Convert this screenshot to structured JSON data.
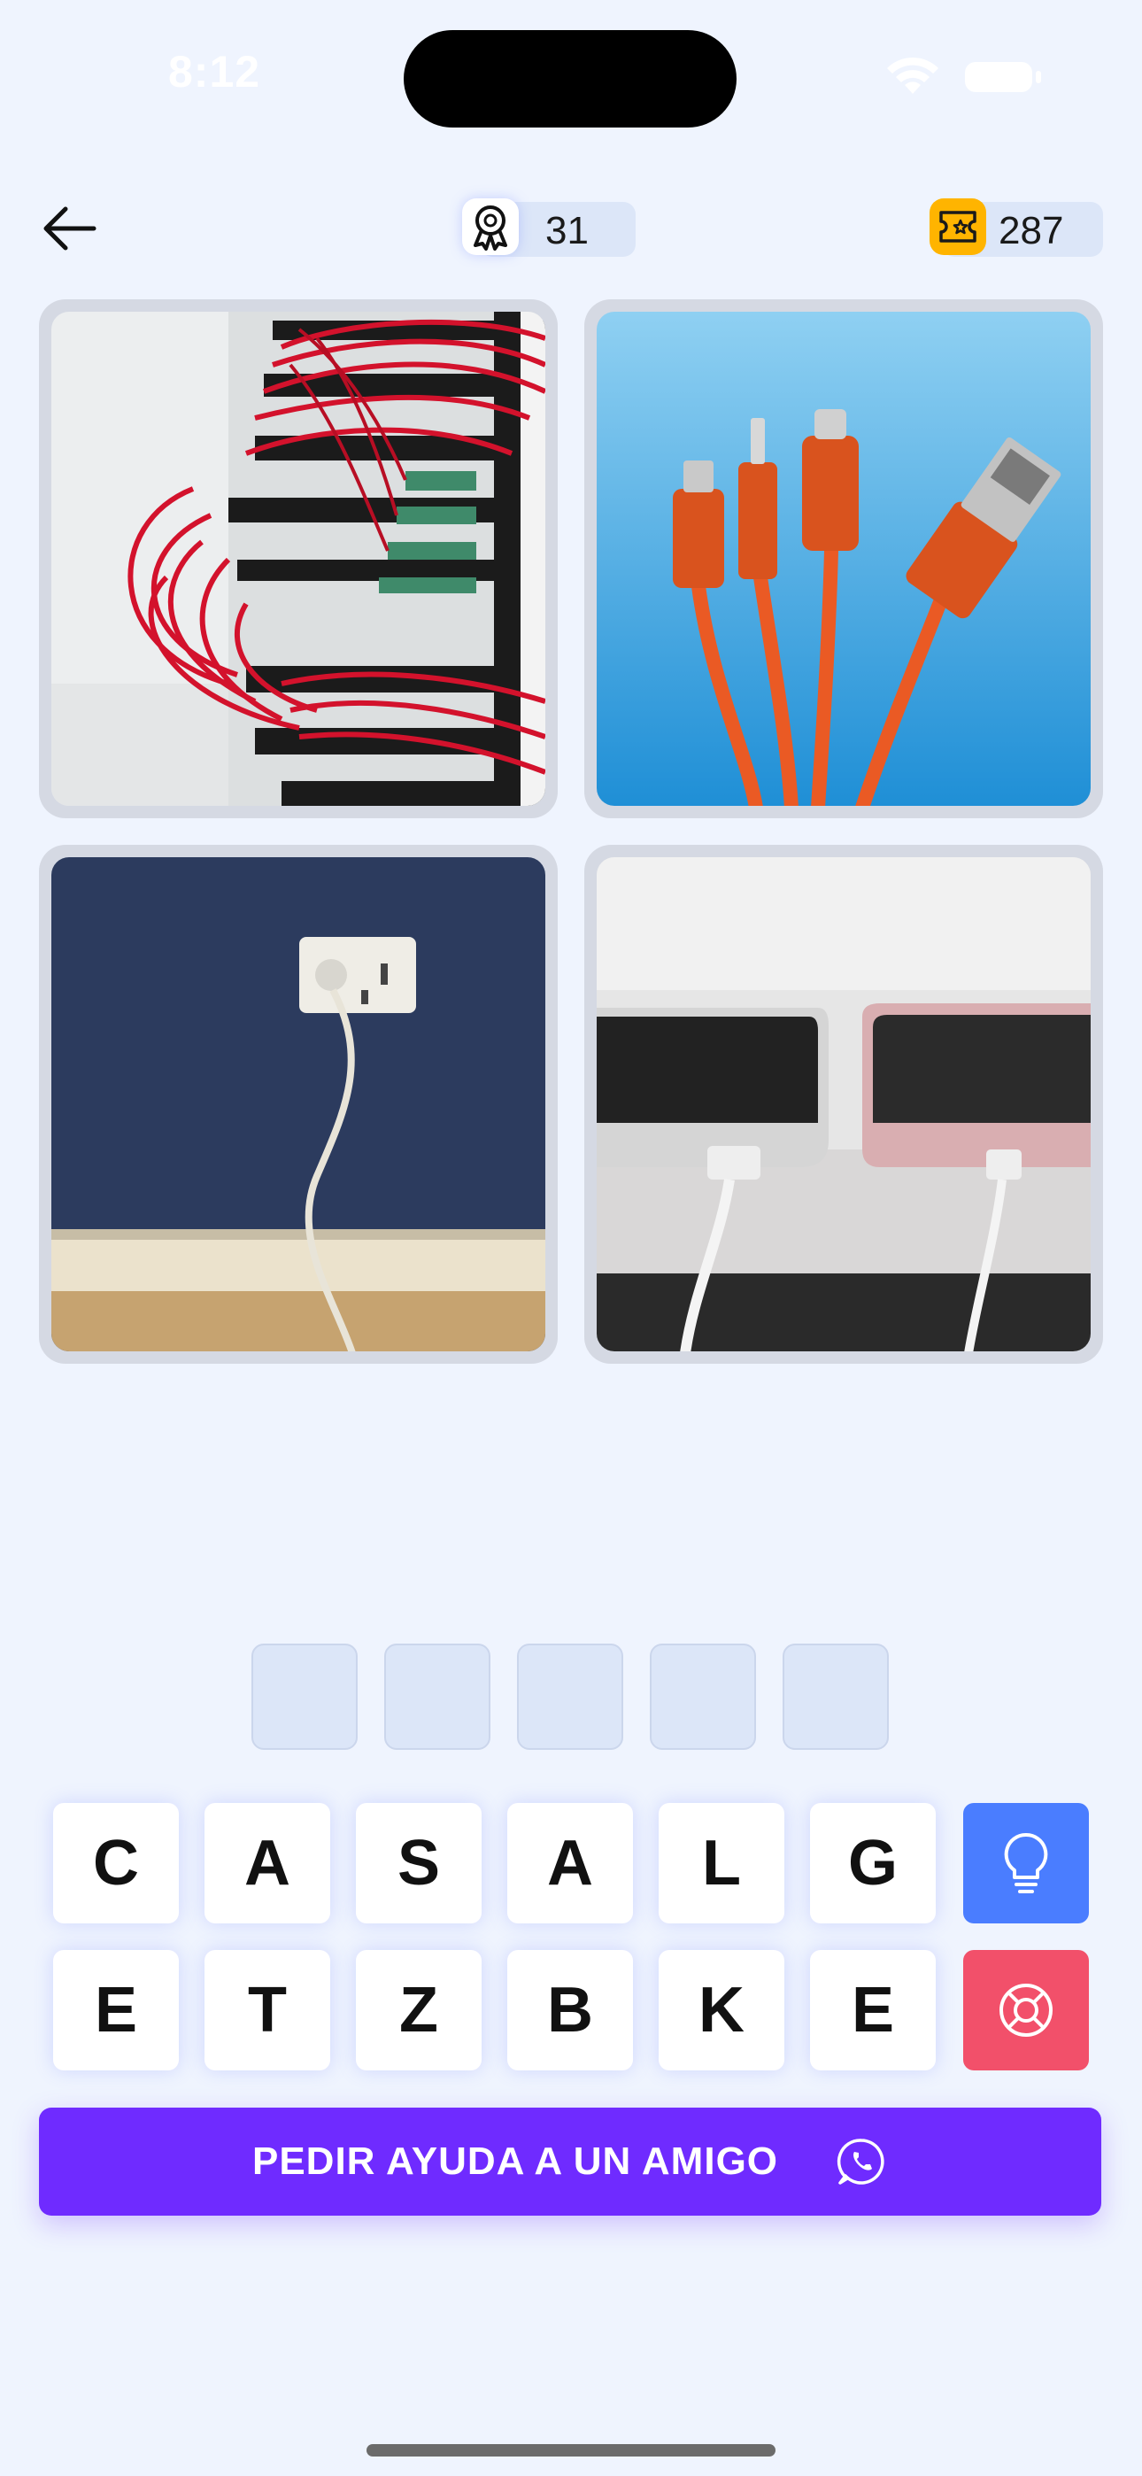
{
  "status_bar": {
    "time": "8:12"
  },
  "header": {
    "level": "31",
    "coins": "287",
    "level_icon": "award-ribbon-icon",
    "coins_icon": "ticket-icon",
    "back_icon": "arrow-left-icon"
  },
  "images": [
    {
      "name": "network-cables-photo"
    },
    {
      "name": "usb-charging-cables-photo"
    },
    {
      "name": "wall-outlet-cable-photo"
    },
    {
      "name": "phones-charging-photo"
    }
  ],
  "answer_slots": [
    "",
    "",
    "",
    "",
    ""
  ],
  "keyboard": {
    "row1": [
      "C",
      "A",
      "S",
      "A",
      "L",
      "G"
    ],
    "row2": [
      "E",
      "T",
      "Z",
      "B",
      "K",
      "E"
    ],
    "hint_icon": "lightbulb-icon",
    "help_icon": "lifebuoy-icon",
    "hint_color": "#4a7dff",
    "help_color": "#f2506a"
  },
  "cta": {
    "label": "PEDIR AYUDA A UN AMIGO",
    "icon": "whatsapp-icon",
    "color": "#6f2bff"
  }
}
